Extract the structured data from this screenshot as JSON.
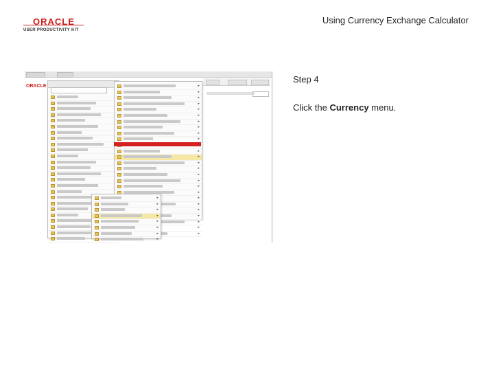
{
  "header": {
    "logo_brand": "ORACLE",
    "logo_subtitle": "USER PRODUCTIVITY KIT",
    "doc_title": "Using Currency Exchange Calculator"
  },
  "step": {
    "label": "Step 4",
    "instruction_pre": "Click the ",
    "instruction_target": "Currency",
    "instruction_post": " menu."
  },
  "colors": {
    "brand_red": "#cc1f1f",
    "highlight_red": "#d42020",
    "folder_yellow": "#e8c25a"
  },
  "screenshot": {
    "menu1_rows": 29,
    "menu2_rows": 26,
    "menu3_rows": 8,
    "highlighted_menu2_row_index": 12
  }
}
